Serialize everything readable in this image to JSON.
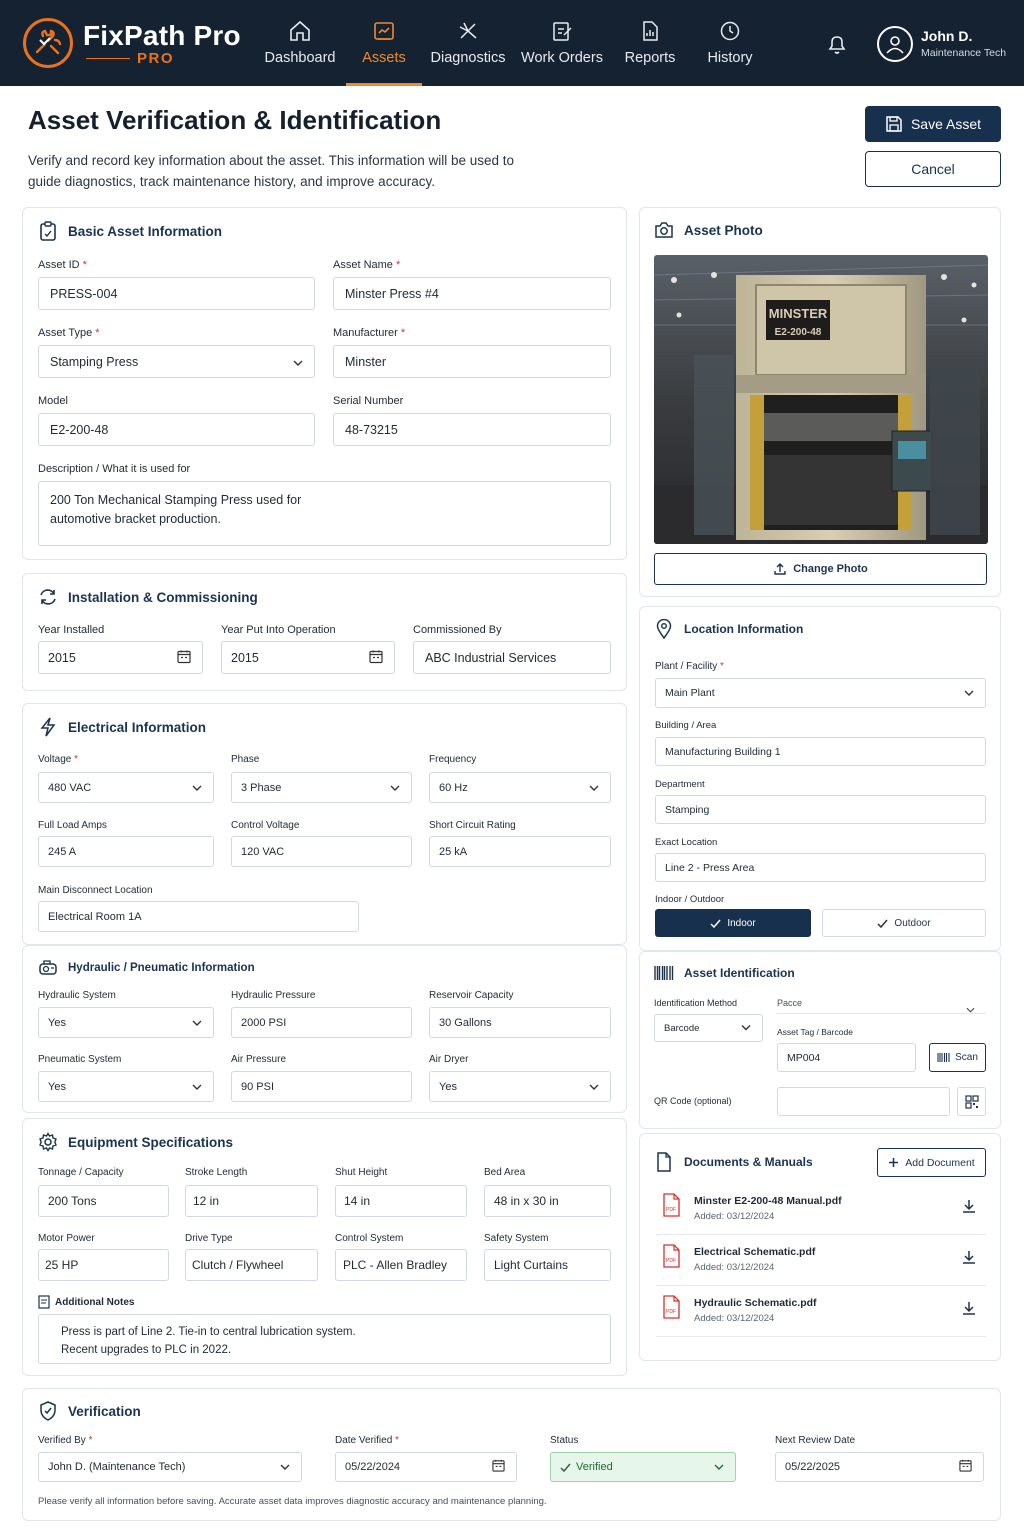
{
  "brand": {
    "name": "FixPath Pro",
    "sub": "PRO"
  },
  "nav": [
    {
      "label": "Dashboard"
    },
    {
      "label": "Assets"
    },
    {
      "label": "Diagnostics"
    },
    {
      "label": "Work Orders"
    },
    {
      "label": "Reports"
    },
    {
      "label": "History"
    }
  ],
  "user": {
    "name": "John D.",
    "role": "Maintenance Tech"
  },
  "page": {
    "title": "Asset Verification & Identification",
    "description": "Verify and record key information about the asset. This information will be used to guide diagnostics, track maintenance history, and improve accuracy.",
    "save_label": "Save Asset",
    "cancel_label": "Cancel"
  },
  "basic": {
    "title": "Basic Asset Information",
    "asset_id_label": "Asset ID",
    "asset_id": "PRESS-004",
    "asset_name_label": "Asset Name",
    "asset_name": "Minster Press #4",
    "asset_type_label": "Asset Type",
    "asset_type": "Stamping Press",
    "manufacturer_label": "Manufacturer",
    "manufacturer": "Minster",
    "model_label": "Model",
    "model": "E2-200-48",
    "serial_label": "Serial Number",
    "serial": "48-73215",
    "desc_label": "Description / What it is used for",
    "desc": "200 Ton Mechanical Stamping Press used for automotive bracket production."
  },
  "install": {
    "title": "Installation & Commissioning",
    "year_installed_label": "Year Installed",
    "year_installed": "2015",
    "year_op_label": "Year Put Into Operation",
    "year_op": "2015",
    "commissioned_label": "Commissioned By",
    "commissioned": "ABC Industrial Services"
  },
  "electrical": {
    "title": "Electrical Information",
    "voltage_label": "Voltage",
    "voltage": "480 VAC",
    "phase_label": "Phase",
    "phase": "3 Phase",
    "freq_label": "Frequency",
    "freq": "60 Hz",
    "fla_label": "Full Load Amps",
    "fla": "245 A",
    "cv_label": "Control Voltage",
    "cv": "120 VAC",
    "sc_label": "Short Circuit Rating",
    "sc": "25 kA",
    "disc_label": "Main Disconnect Location",
    "disc": "Electrical Room 1A"
  },
  "hydraulic": {
    "title": "Hydraulic / Pneumatic Information",
    "hs_label": "Hydraulic System",
    "hs": "Yes",
    "hp_label": "Hydraulic Pressure",
    "hp": "2000 PSI",
    "rc_label": "Reservoir Capacity",
    "rc": "30 Gallons",
    "ps_label": "Pneumatic System",
    "ps": "Yes",
    "ap_label": "Air Pressure",
    "ap": "90 PSI",
    "ad_label": "Air Dryer",
    "ad": "Yes"
  },
  "specs": {
    "title": "Equipment Specifications",
    "tonnage_label": "Tonnage / Capacity",
    "tonnage": "200 Tons",
    "stroke_label": "Stroke Length",
    "stroke": "12 in",
    "shut_label": "Shut Height",
    "shut": "14 in",
    "bed_label": "Bed Area",
    "bed": "48 in x 30 in",
    "motor_label": "Motor Power",
    "motor": "25 HP",
    "drive_label": "Drive Type",
    "drive": "Clutch / Flywheel",
    "control_label": "Control System",
    "control": "PLC - Allen Bradley",
    "safety_label": "Safety System",
    "safety": "Light Curtains",
    "notes_label": "Additional Notes",
    "notes": "Press is part of Line 2. Tie-in to central lubrication system. Recent upgrades to PLC in 2022."
  },
  "photo": {
    "title": "Asset Photo",
    "plate_brand": "MINSTER",
    "plate_model": "E2-200-48",
    "change_label": "Change Photo"
  },
  "location": {
    "title": "Location Information",
    "plant_label": "Plant / Facility",
    "plant": "Main Plant",
    "building_label": "Building / Area",
    "building": "Manufacturing Building 1",
    "dept_label": "Department",
    "dept": "Stamping",
    "exact_label": "Exact Location",
    "exact": "Line 2 - Press Area",
    "io_label": "Indoor / Outdoor",
    "indoor": "Indoor",
    "outdoor": "Outdoor"
  },
  "ident": {
    "title": "Asset Identification",
    "method_label": "Identification Method",
    "method": "Barcode",
    "faded_label": "Pacce",
    "tag_label": "Asset Tag / Barcode",
    "tag": "MP004",
    "scan_label": "Scan",
    "qr_label": "QR Code (optional)"
  },
  "docs": {
    "title": "Documents & Manuals",
    "add_label": "Add Document",
    "items": [
      {
        "name": "Minster E2-200-48 Manual.pdf",
        "date": "Added: 03/12/2024"
      },
      {
        "name": "Electrical Schematic.pdf",
        "date": "Added: 03/12/2024"
      },
      {
        "name": "Hydraulic Schematic.pdf",
        "date": "Added: 03/12/2024"
      }
    ]
  },
  "verify": {
    "title": "Verification",
    "by_label": "Verified By",
    "by": "John D. (Maintenance Tech)",
    "date_label": "Date Verified",
    "date": "05/22/2024",
    "status_label": "Status",
    "status": "Verified",
    "next_label": "Next Review Date",
    "next": "05/22/2025",
    "footnote": "Please verify all information before saving. Accurate asset data improves diagnostic accuracy and maintenance planning."
  },
  "colors": {
    "navbar": "#152231",
    "accent": "#e8731c",
    "primary": "#17304d",
    "verified_bg": "#e7f6ea"
  }
}
